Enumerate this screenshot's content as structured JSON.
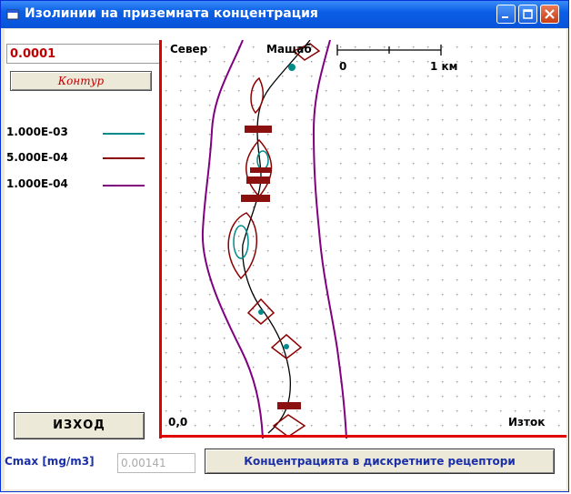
{
  "window": {
    "title": "Изолинии на приземната концентрация",
    "min_icon": "minimize-icon",
    "max_icon": "maximize-icon",
    "close_icon": "close-icon"
  },
  "controls": {
    "level_value": "0.0001",
    "contour_button": "Контур",
    "exit_button": "ИЗХОД",
    "receptors_button": "Концентрацията в дискретните рецептори"
  },
  "legend": [
    {
      "label": "1.000E-03",
      "color": "#008b8b"
    },
    {
      "label": "5.000E-04",
      "color": "#8b0000"
    },
    {
      "label": "1.000E-04",
      "color": "#800080"
    }
  ],
  "map": {
    "north_label": "Север",
    "scale_label": "Мащаб",
    "scale_start": "0",
    "scale_end": "1 км",
    "origin_label": "0,0",
    "east_label": "Изток"
  },
  "cmax": {
    "label": "Cmax [mg/m3]",
    "value": "0.00141"
  },
  "colors": {
    "accent_red": "#e00000",
    "label_blue": "#1b2fa8"
  }
}
